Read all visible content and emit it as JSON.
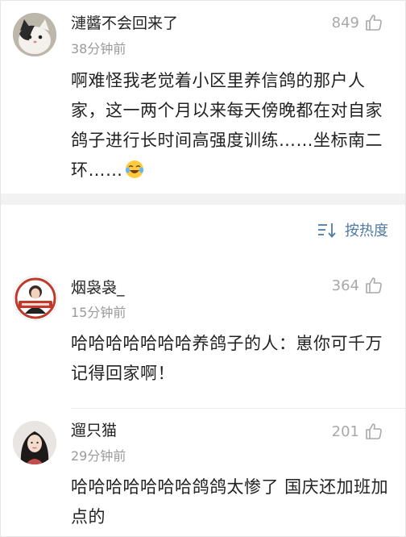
{
  "comments_top": [
    {
      "username": "漣醬不会回来了",
      "time": "38分钟前",
      "likes": "849",
      "text": "啊难怪我老觉着小区里养信鸽的那户人家，这一两个月以来每天傍晚都在对自家鸽子进行长时间高强度训练……坐标南二环……",
      "avatar_icon": "cat-avatar-icon",
      "trailing_emoji": "laughing-crying-emoji-icon"
    }
  ],
  "sort": {
    "label": "按热度",
    "icon": "sort-icon"
  },
  "comments_hot": [
    {
      "username": "烟袅袅_",
      "time": "15分钟前",
      "likes": "364",
      "text": "哈哈哈哈哈哈哈养鸽子的人：崽你可千万记得回家啊！",
      "avatar_icon": "fan-badge-avatar-icon"
    },
    {
      "username": "遛只猫",
      "time": "29分钟前",
      "likes": "201",
      "text": "哈哈哈哈哈哈哈鸽鸽太惨了 国庆还加班加点的",
      "avatar_icon": "girl-avatar-icon"
    }
  ],
  "colors": {
    "accent": "#4f7aa3",
    "muted": "#9a9a9a",
    "gap": "#f2f2f2"
  }
}
